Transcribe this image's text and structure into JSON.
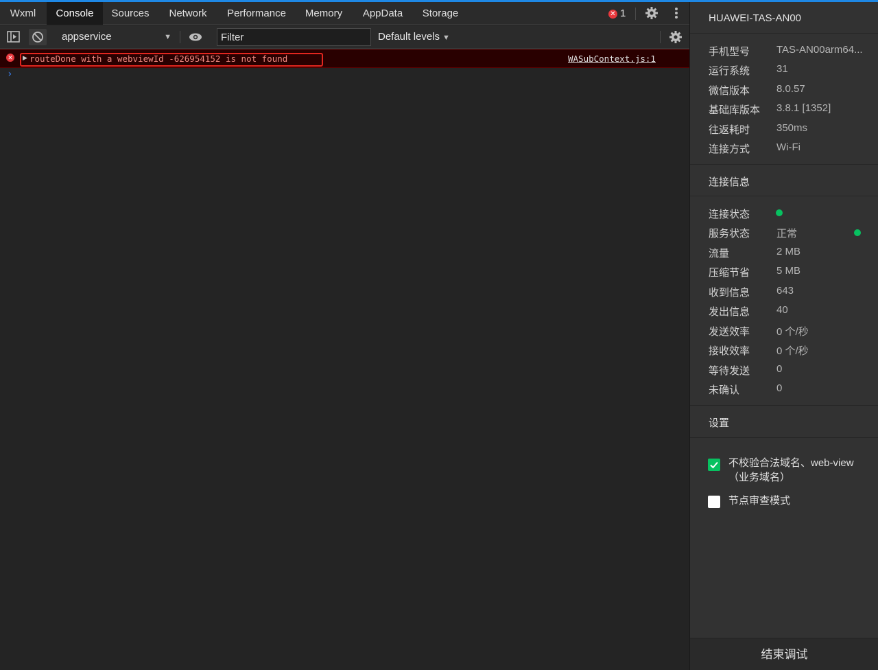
{
  "tabs": [
    {
      "label": "Wxml"
    },
    {
      "label": "Console",
      "active": true
    },
    {
      "label": "Sources"
    },
    {
      "label": "Network"
    },
    {
      "label": "Performance"
    },
    {
      "label": "Memory"
    },
    {
      "label": "AppData"
    },
    {
      "label": "Storage"
    }
  ],
  "error_count": "1",
  "toolbar": {
    "context": "appservice",
    "filter_placeholder": "Filter",
    "levels": "Default levels"
  },
  "console": {
    "messages": [
      {
        "level": "error",
        "text": "routeDone with a webviewId -626954152 is not found",
        "source": "WASubContext.js:1"
      }
    ],
    "prompt": "›"
  },
  "side": {
    "device_title": "HUAWEI-TAS-AN00",
    "device_info": [
      {
        "key": "手机型号",
        "value": "TAS-AN00arm64..."
      },
      {
        "key": "运行系统",
        "value": "31"
      },
      {
        "key": "微信版本",
        "value": "8.0.57"
      },
      {
        "key": "基础库版本",
        "value": "3.8.1 [1352]"
      },
      {
        "key": "往返耗时",
        "value": "350ms"
      },
      {
        "key": "连接方式",
        "value": "Wi-Fi"
      }
    ],
    "connection_title": "连接信息",
    "connection_info": [
      {
        "key": "连接状态",
        "value": ""
      },
      {
        "key": "服务状态",
        "value": "正常"
      },
      {
        "key": "流量",
        "value": "2 MB"
      },
      {
        "key": "压缩节省",
        "value": "5 MB"
      },
      {
        "key": "收到信息",
        "value": "643"
      },
      {
        "key": "发出信息",
        "value": "40"
      },
      {
        "key": "发送效率",
        "value": "0 个/秒"
      },
      {
        "key": "接收效率",
        "value": "0 个/秒"
      },
      {
        "key": "等待发送",
        "value": "0"
      },
      {
        "key": "未确认",
        "value": "0"
      }
    ],
    "settings_title": "设置",
    "settings": [
      {
        "label": "不校验合法域名、web-view（业务域名）",
        "checked": true
      },
      {
        "label": "节点审查模式",
        "checked": false
      }
    ],
    "footer_button": "结束调试"
  },
  "colors": {
    "accent_green": "#07c160",
    "error_red": "#e8383d",
    "highlight_box": "#e3261f"
  }
}
